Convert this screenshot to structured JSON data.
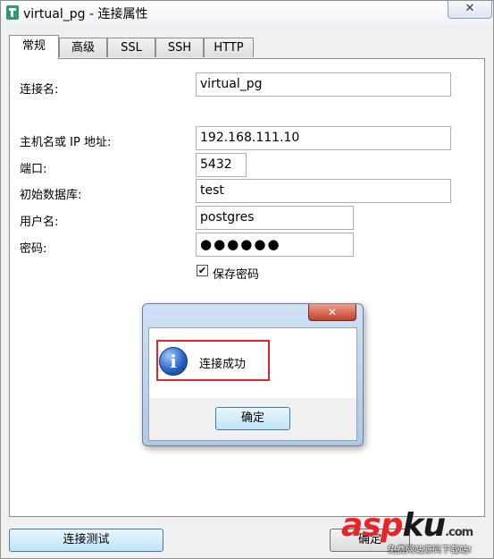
{
  "window": {
    "title": "virtual_pg - 连接属性",
    "close_glyph": "✕"
  },
  "tabs": [
    {
      "label": "常规",
      "active": true
    },
    {
      "label": "高级",
      "active": false
    },
    {
      "label": "SSL",
      "active": false
    },
    {
      "label": "SSH",
      "active": false
    },
    {
      "label": "HTTP",
      "active": false
    }
  ],
  "form": {
    "connection_name": {
      "label": "连接名:",
      "value": "virtual_pg"
    },
    "host": {
      "label": "主机名或 IP 地址:",
      "value": "192.168.111.10"
    },
    "port": {
      "label": "端口:",
      "value": "5432"
    },
    "database": {
      "label": "初始数据库:",
      "value": "test"
    },
    "username": {
      "label": "用户名:",
      "value": "postgres"
    },
    "password": {
      "label": "密码:",
      "value": "●●●●●●"
    },
    "save_password": {
      "label": "保存密码",
      "checked": true,
      "check_glyph": "✔"
    }
  },
  "buttons": {
    "test_connection": "连接测试",
    "ok_partial": "确定"
  },
  "dialog": {
    "close_glyph": "✕",
    "message": "连接成功",
    "ok_button": "确定",
    "icon_glyph": "i"
  },
  "watermark": {
    "text_asp": "asp",
    "text_ku": "ku",
    "text_com": ".com",
    "subtitle": "免费网站源码下载站!",
    "color_asp": "#e8232a",
    "color_ku": "#1a1a1a"
  },
  "colors": {
    "accent": "#3c7fb1",
    "highlight_border": "#e0262d",
    "dialog_close": "#c4402a"
  }
}
